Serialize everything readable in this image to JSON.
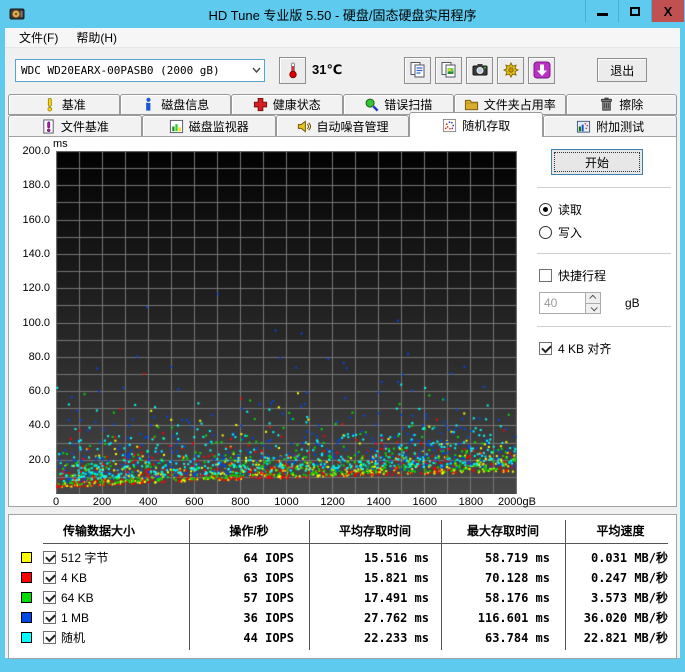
{
  "window": {
    "title": "HD Tune 专业版 5.50 - 硬盘/固态硬盘实用程序",
    "controls": {
      "close": "X"
    }
  },
  "menu": {
    "file": "文件(F)",
    "help": "帮助(H)"
  },
  "toolbar": {
    "drive": "WDC WD20EARX-00PASB0 (2000 gB)",
    "temperature": "31℃",
    "exit_label": "退出",
    "buttons": [
      {
        "name": "copy-text-button",
        "icon": "copy-text-icon"
      },
      {
        "name": "copy-image-button",
        "icon": "copy-image-icon"
      },
      {
        "name": "screenshot-button",
        "icon": "camera-icon"
      },
      {
        "name": "options-button",
        "icon": "gold-burst-icon"
      },
      {
        "name": "update-button",
        "icon": "purple-download-icon"
      }
    ]
  },
  "tabs": {
    "row1": [
      {
        "id": "benchmark",
        "label": "基准",
        "icon": "exclamation-icon",
        "active": false
      },
      {
        "id": "disk-info",
        "label": "磁盘信息",
        "icon": "info-icon",
        "active": false
      },
      {
        "id": "health",
        "label": "健康状态",
        "icon": "red-cross-icon",
        "active": false
      },
      {
        "id": "error-scan",
        "label": "错误扫描",
        "icon": "magnifier-icon",
        "active": false
      },
      {
        "id": "folder-usage",
        "label": "文件夹占用率",
        "icon": "folder-icon",
        "active": false
      },
      {
        "id": "erase",
        "label": "擦除",
        "icon": "trash-icon",
        "active": false
      }
    ],
    "row2": [
      {
        "id": "file-benchmark",
        "label": "文件基准",
        "icon": "doc-exclamation-icon",
        "active": false
      },
      {
        "id": "disk-monitor",
        "label": "磁盘监视器",
        "icon": "bar-chart-icon",
        "active": false
      },
      {
        "id": "aam",
        "label": "自动噪音管理",
        "icon": "speaker-icon",
        "active": false
      },
      {
        "id": "random-access",
        "label": "随机存取",
        "icon": "scatter-icon",
        "active": true
      },
      {
        "id": "extra-tests",
        "label": "附加测试",
        "icon": "mini-chart-icon",
        "active": false
      }
    ]
  },
  "controls": {
    "start_label": "开始",
    "read_label": "读取",
    "write_label": "写入",
    "mode_selected": "读取",
    "short_stroke_label": "快捷行程",
    "short_stroke_checked": false,
    "short_stroke_value": "40",
    "short_stroke_unit": "gB",
    "align_label": "4 KB 对齐",
    "align_checked": true
  },
  "chart_data": {
    "type": "scatter",
    "title": "Random access time vs disk position",
    "x_unit": "gB",
    "y_unit": "ms",
    "xlim": [
      0,
      2000
    ],
    "ylim": [
      0,
      200
    ],
    "x_grid_step": 100,
    "y_grid_step": 10,
    "x_tick_labels": [
      "0",
      "200",
      "400",
      "600",
      "800",
      "1000",
      "1200",
      "1400",
      "1600",
      "1800",
      "2000gB"
    ],
    "y_tick_labels": [
      "200.0",
      "180.0",
      "160.0",
      "140.0",
      "120.0",
      "100.0",
      "80.0",
      "60.0",
      "40.0",
      "20.0"
    ],
    "bg_gradient": [
      "#020202",
      "#474747"
    ],
    "grid_color": "#757575",
    "legend_position": "bottom-table",
    "seed": 1337,
    "points_per_series": 420,
    "base_curve": {
      "min_ms": 3,
      "rise_ms": 10,
      "power": 0.7
    },
    "series": [
      {
        "name": "512 字节",
        "color": "#FFFF00",
        "iops": 64,
        "avg_ms": 15.516,
        "max_ms": 58.719,
        "speed_mb_s": 0.031,
        "base_offset": 0,
        "noise_mean": 6.6,
        "max_point_x": 1050
      },
      {
        "name": "4 KB",
        "color": "#FF0000",
        "iops": 63,
        "avg_ms": 15.821,
        "max_ms": 70.128,
        "speed_mb_s": 0.247,
        "base_offset": 0,
        "noise_mean": 6.9,
        "max_point_x": 380
      },
      {
        "name": "64 KB",
        "color": "#00DD00",
        "iops": 57,
        "avg_ms": 17.491,
        "max_ms": 58.176,
        "speed_mb_s": 3.573,
        "base_offset": 1,
        "noise_mean": 7.6,
        "max_point_x": 120
      },
      {
        "name": "1 MB",
        "color": "#0047E8",
        "iops": 36,
        "avg_ms": 27.762,
        "max_ms": 116.601,
        "speed_mb_s": 36.02,
        "base_offset": 3,
        "noise_mean": 15.9,
        "max_point_x": 700
      },
      {
        "name": "随机",
        "color": "#00FFFF",
        "iops": 44,
        "avg_ms": 22.233,
        "max_ms": 63.784,
        "speed_mb_s": 22.821,
        "base_offset": 4,
        "noise_mean": 9.3,
        "max_point_x": 1500
      }
    ]
  },
  "table": {
    "headers": [
      "传输数据大小",
      "操作/秒",
      "平均存取时间",
      "最大存取时间",
      "平均速度"
    ],
    "rows": [
      {
        "color": "#FFFF00",
        "checked": true,
        "label": "512 字节",
        "ops": "64 IOPS",
        "avg": "15.516 ms",
        "max": "58.719 ms",
        "speed": "0.031 MB/秒"
      },
      {
        "color": "#FF0000",
        "checked": true,
        "label": "4 KB",
        "ops": "63 IOPS",
        "avg": "15.821 ms",
        "max": "70.128 ms",
        "speed": "0.247 MB/秒"
      },
      {
        "color": "#00DD00",
        "checked": true,
        "label": "64 KB",
        "ops": "57 IOPS",
        "avg": "17.491 ms",
        "max": "58.176 ms",
        "speed": "3.573 MB/秒"
      },
      {
        "color": "#0047E8",
        "checked": true,
        "label": "1 MB",
        "ops": "36 IOPS",
        "avg": "27.762 ms",
        "max": "116.601 ms",
        "speed": "36.020 MB/秒"
      },
      {
        "color": "#00FFFF",
        "checked": true,
        "label": "随机",
        "ops": "44 IOPS",
        "avg": "22.233 ms",
        "max": "63.784 ms",
        "speed": "22.821 MB/秒"
      }
    ]
  }
}
